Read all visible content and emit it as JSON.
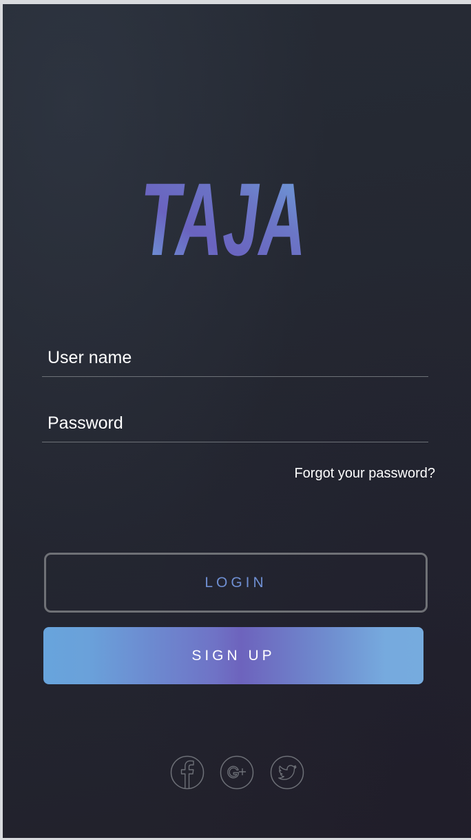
{
  "app": {
    "logo_text": "TAJA"
  },
  "form": {
    "username_placeholder": "User name",
    "password_placeholder": "Password",
    "forgot_label": "Forgot your password?"
  },
  "buttons": {
    "login_label": "LOGIN",
    "signup_label": "SIGN UP"
  },
  "social": {
    "icons": [
      "facebook-icon",
      "google-plus-icon",
      "twitter-icon"
    ]
  },
  "colors": {
    "background": "#242731",
    "login_text": "#6f8fd2",
    "gradient_blue": "#68a4dc",
    "gradient_purple": "#6d63bd"
  }
}
